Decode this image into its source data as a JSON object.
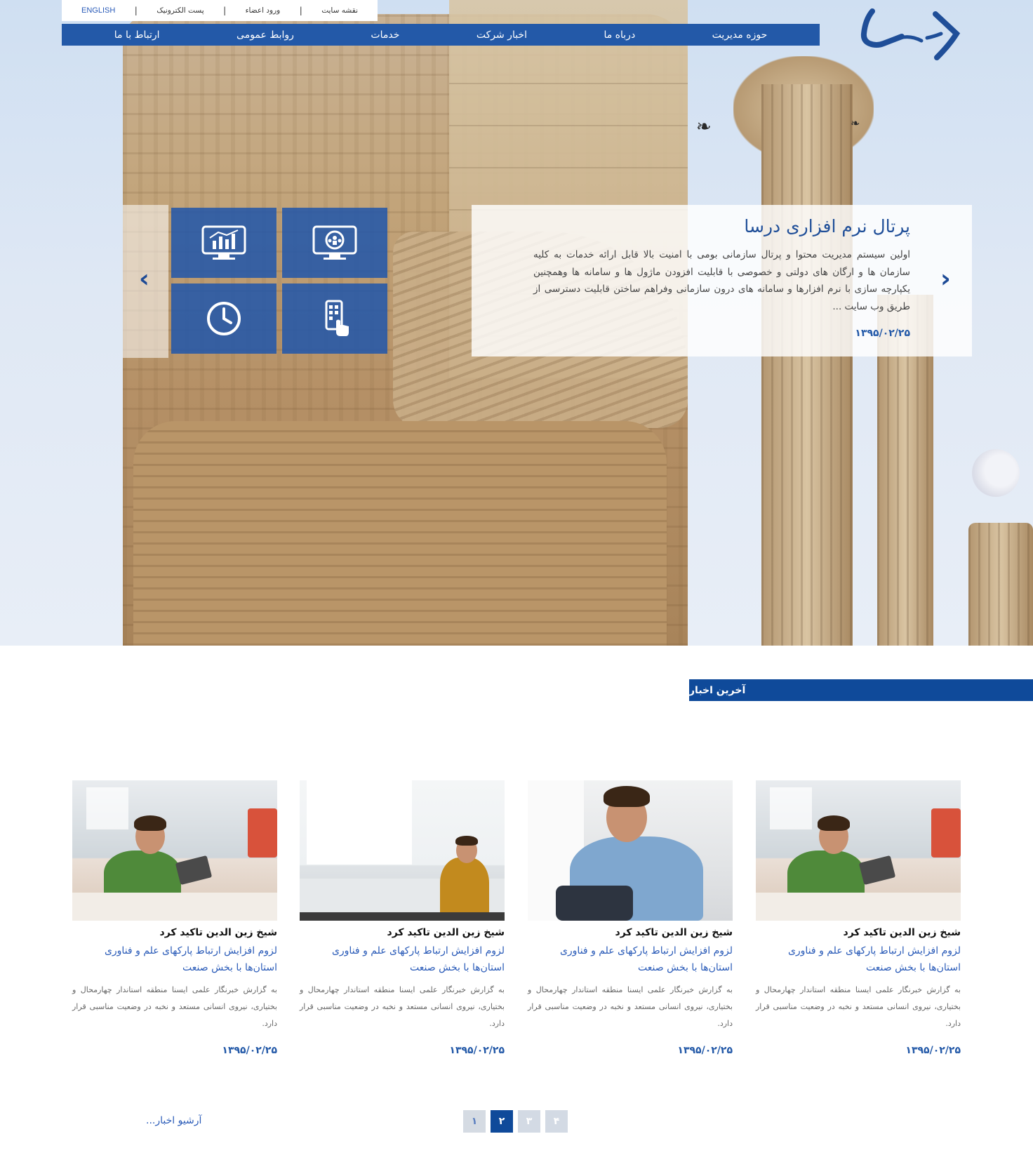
{
  "top_links": {
    "site_map": "نقشه سایت",
    "members_login": "ورود اعضاء",
    "email": "پست الکترونیک",
    "english": "ENGLISH",
    "separator": "|"
  },
  "nav": {
    "items": [
      "حوزه مدیریت",
      "درباه ما",
      "اخبار شرکت",
      "خدمات",
      "روابط عمومی",
      "ارتباط با ما"
    ]
  },
  "slider": {
    "title": "پرتال نرم افزاری درسا",
    "text": "اولین سیستم مدیریت محتوا و پرتال سازمانی بومی با امنیت بالا قابل ارائه خدمات به کلیه سازمان ها و ارگان های دولتی و خصوصی با قابلیت افزودن ماژول ها و سامانه ها وهمچنین یکپارچه سازی با نرم افزارها و سامانه های درون سازمانی وفراهم ساختن قابلیت دسترسی از طریق وب سایت ...",
    "date": "۱۳۹۵/۰۲/۲۵",
    "prev_icon": "chevron-left-icon",
    "next_icon": "chevron-right-icon",
    "tile_icons": [
      "monitor-network-icon",
      "monitor-chart-icon",
      "mobile-touch-icon",
      "clock-icon"
    ]
  },
  "news": {
    "header": "آخرین اخبار",
    "cards": [
      {
        "title": "شیخ زین الدین تاکید کرد",
        "subtitle": "لزوم افزایش ارتباط پارکهای علم و فناوری استان‌ها با بخش صنعت",
        "text": "به گزارش خبرنگار علمی ایسنا منطقه استاندار چهارمحال و بختیاری، نیروی انسانی مستعد و نخبه در وضعیت مناسبی قرار دارد.",
        "date": "۱۳۹۵/۰۲/۲۵"
      },
      {
        "title": "شیخ زین الدین تاکید کرد",
        "subtitle": "لزوم افزایش ارتباط پارکهای علم و فناوری استان‌ها با بخش صنعت",
        "text": "به گزارش خبرنگار علمی ایسنا منطقه استاندار چهارمحال و بختیاری، نیروی انسانی مستعد و نخبه در وضعیت مناسبی قرار دارد.",
        "date": "۱۳۹۵/۰۲/۲۵"
      },
      {
        "title": "شیخ زین الدین تاکید کرد",
        "subtitle": "لزوم افزایش ارتباط پارکهای علم و فناوری استان‌ها با بخش صنعت",
        "text": "به گزارش خبرنگار علمی ایسنا منطقه استاندار چهارمحال و بختیاری، نیروی انسانی مستعد و نخبه در وضعیت مناسبی قرار دارد.",
        "date": "۱۳۹۵/۰۲/۲۵"
      },
      {
        "title": "شیخ زین الدین تاکید کرد",
        "subtitle": "لزوم افزایش ارتباط پارکهای علم و فناوری استان‌ها با بخش صنعت",
        "text": "به گزارش خبرنگار علمی ایسنا منطقه استاندار چهارمحال و بختیاری، نیروی انسانی مستعد و نخبه در وضعیت مناسبی قرار دارد.",
        "date": "۱۳۹۵/۰۲/۲۵"
      }
    ],
    "archive": "آرشیو اخبار...",
    "pages": [
      "۱",
      "۲",
      "۳",
      "۴"
    ],
    "active_page": "۲"
  },
  "colors": {
    "brand_blue": "#2359a8",
    "dark_blue": "#0f4a9a",
    "link_blue": "#2a5bb8"
  }
}
